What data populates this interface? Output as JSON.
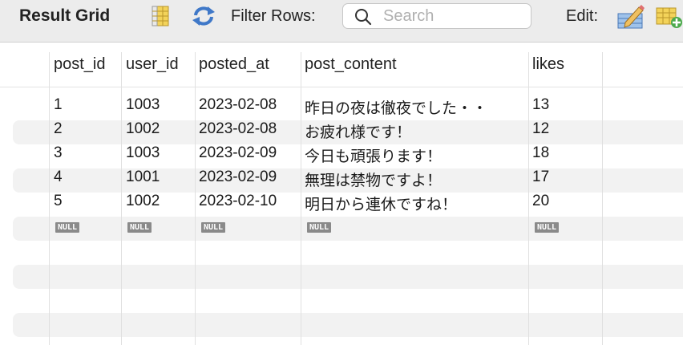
{
  "toolbar": {
    "title": "Result Grid",
    "filter_label": "Filter Rows:",
    "search_placeholder": "Search",
    "edit_label": "Edit:"
  },
  "columns": [
    "post_id",
    "user_id",
    "posted_at",
    "post_content",
    "likes"
  ],
  "rows": [
    [
      "1",
      "1003",
      "2023-02-08",
      "昨日の夜は徹夜でした・・",
      "13"
    ],
    [
      "2",
      "1002",
      "2023-02-08",
      "お疲れ様です！",
      "12"
    ],
    [
      "3",
      "1003",
      "2023-02-09",
      "今日も頑張ります！",
      "18"
    ],
    [
      "4",
      "1001",
      "2023-02-09",
      "無理は禁物ですよ！",
      "17"
    ],
    [
      "5",
      "1002",
      "2023-02-10",
      "明日から連休ですね！",
      "20"
    ]
  ],
  "null_label": "NULL",
  "colors": {
    "toolbar_bg": "#ececec",
    "stripe": "#f2f2f2",
    "null_badge": "#8a8a8a"
  }
}
